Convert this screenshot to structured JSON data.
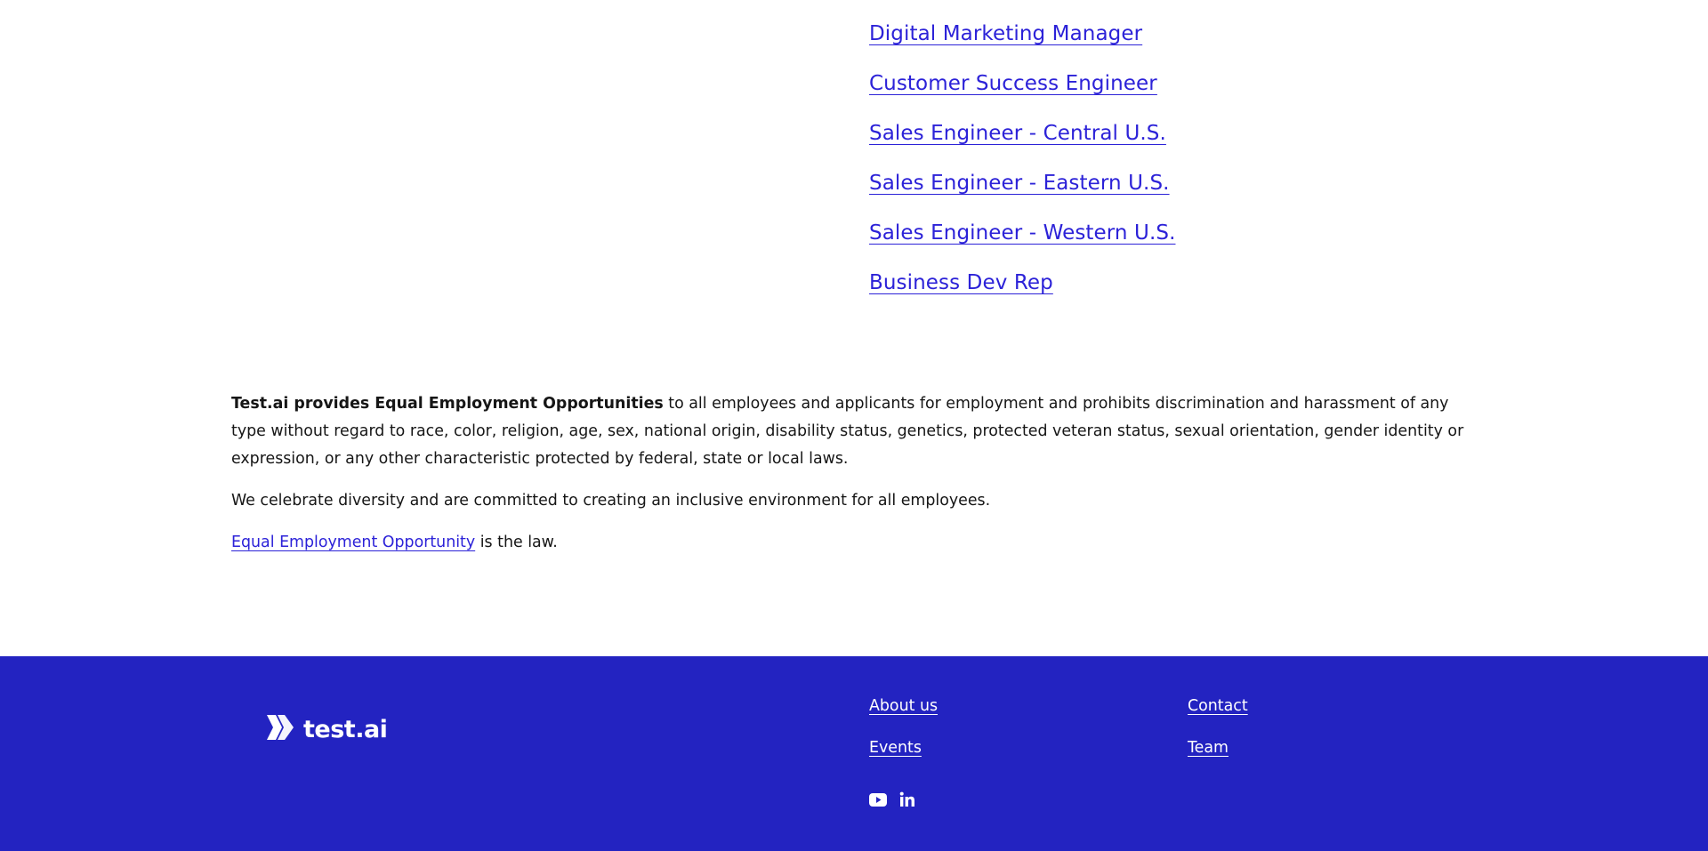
{
  "jobs": [
    {
      "title": "Digital Marketing Manager"
    },
    {
      "title": "Customer Success Engineer"
    },
    {
      "title": "Sales Engineer - Central U.S."
    },
    {
      "title": "Sales Engineer - Eastern U.S."
    },
    {
      "title": "Sales Engineer - Western U.S."
    },
    {
      "title": "Business Dev Rep"
    }
  ],
  "eeo": {
    "bold_lead": "Test.ai provides Equal Employment Opportunities",
    "statement": " to all employees and applicants for employment and prohibits discrimination and harassment of any type without regard to race, color, religion, age, sex, national origin, disability status, genetics, protected veteran status, sexual orientation, gender identity or expression, or any other characteristic protected by federal, state or local laws.",
    "diversity": "We celebrate diversity and are committed to creating an inclusive environment for all employees.",
    "law_link": "Equal Employment Opportunity",
    "law_suffix": " is the law."
  },
  "footer": {
    "logo_text": "test.ai",
    "links_col1": [
      {
        "label": "About us"
      },
      {
        "label": "Events"
      }
    ],
    "links_col2": [
      {
        "label": "Contact"
      },
      {
        "label": "Team"
      }
    ],
    "social": [
      {
        "icon": "youtube-icon"
      },
      {
        "icon": "linkedin-icon"
      }
    ]
  },
  "colors": {
    "link": "#2c22d8",
    "footer_bg": "#2323c1",
    "text": "#161616"
  }
}
